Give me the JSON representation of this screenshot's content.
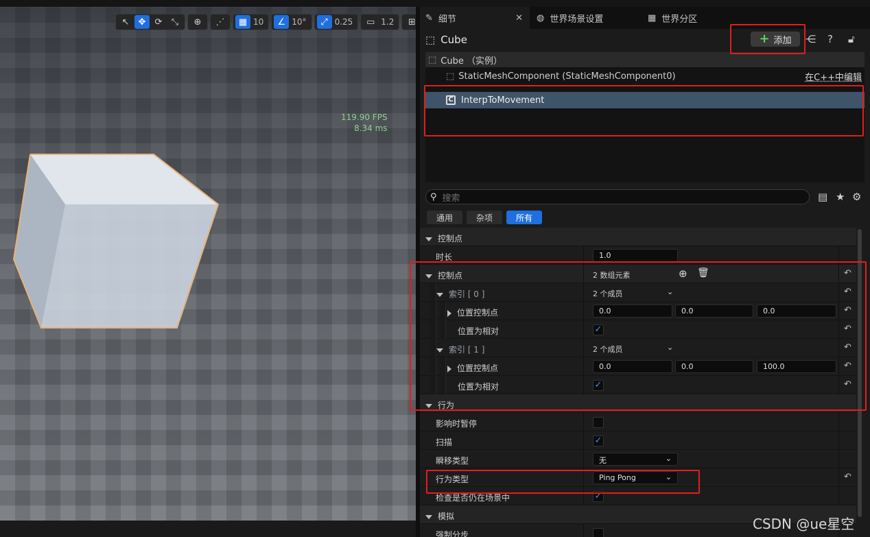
{
  "viewport": {
    "toolbar": {
      "grid_snap": "10",
      "rotate_snap": "10°",
      "scale_snap": "0.25",
      "camera_speed": "1.2"
    },
    "stats": {
      "fps": "119.90 FPS",
      "ms": "8.34 ms"
    }
  },
  "tabs": [
    {
      "label": "细节",
      "icon": "pencil-icon"
    },
    {
      "label": "世界场景设置",
      "icon": "globe-icon"
    },
    {
      "label": "世界分区",
      "icon": "grid-icon"
    }
  ],
  "header": {
    "actor_name": "Cube",
    "add_label": "添加"
  },
  "components": {
    "instance": "Cube （实例）",
    "static_mesh": "StaticMeshComponent (StaticMeshComponent0)",
    "edit_cpp": "在C++中编辑",
    "interp": "InterpToMovement"
  },
  "search": {
    "placeholder": "搜索"
  },
  "filters": [
    "通用",
    "杂项",
    "所有"
  ],
  "props": {
    "cat_control": "控制点",
    "duration_label": "时长",
    "duration_value": "1.0",
    "control_points_label": "控制点",
    "control_points_value": "2 数组元素",
    "index0_label": "索引 [ 0 ]",
    "index0_value": "2 个成员",
    "pos_label": "位置控制点",
    "pos0": [
      "0.0",
      "0.0",
      "0.0"
    ],
    "relative_label": "位置为相对",
    "index1_label": "索引 [ 1 ]",
    "index1_value": "2 个成员",
    "pos1": [
      "0.0",
      "0.0",
      "100.0"
    ],
    "cat_behavior": "行为",
    "pause_label": "影响时暂停",
    "sweep_label": "扫描",
    "teleport_label": "瞬移类型",
    "teleport_value": "无",
    "behavior_type_label": "行为类型",
    "behavior_type_value": "Ping Pong",
    "check_in_scene_label": "检查是否仍在场景中",
    "cat_sim": "模拟",
    "force_sub_label": "强制分步"
  },
  "watermark": "CSDN @ue星空",
  "colors": {
    "accent": "#1f6fe0",
    "highlight": "#e31d1d",
    "selection": "#3f5468"
  }
}
